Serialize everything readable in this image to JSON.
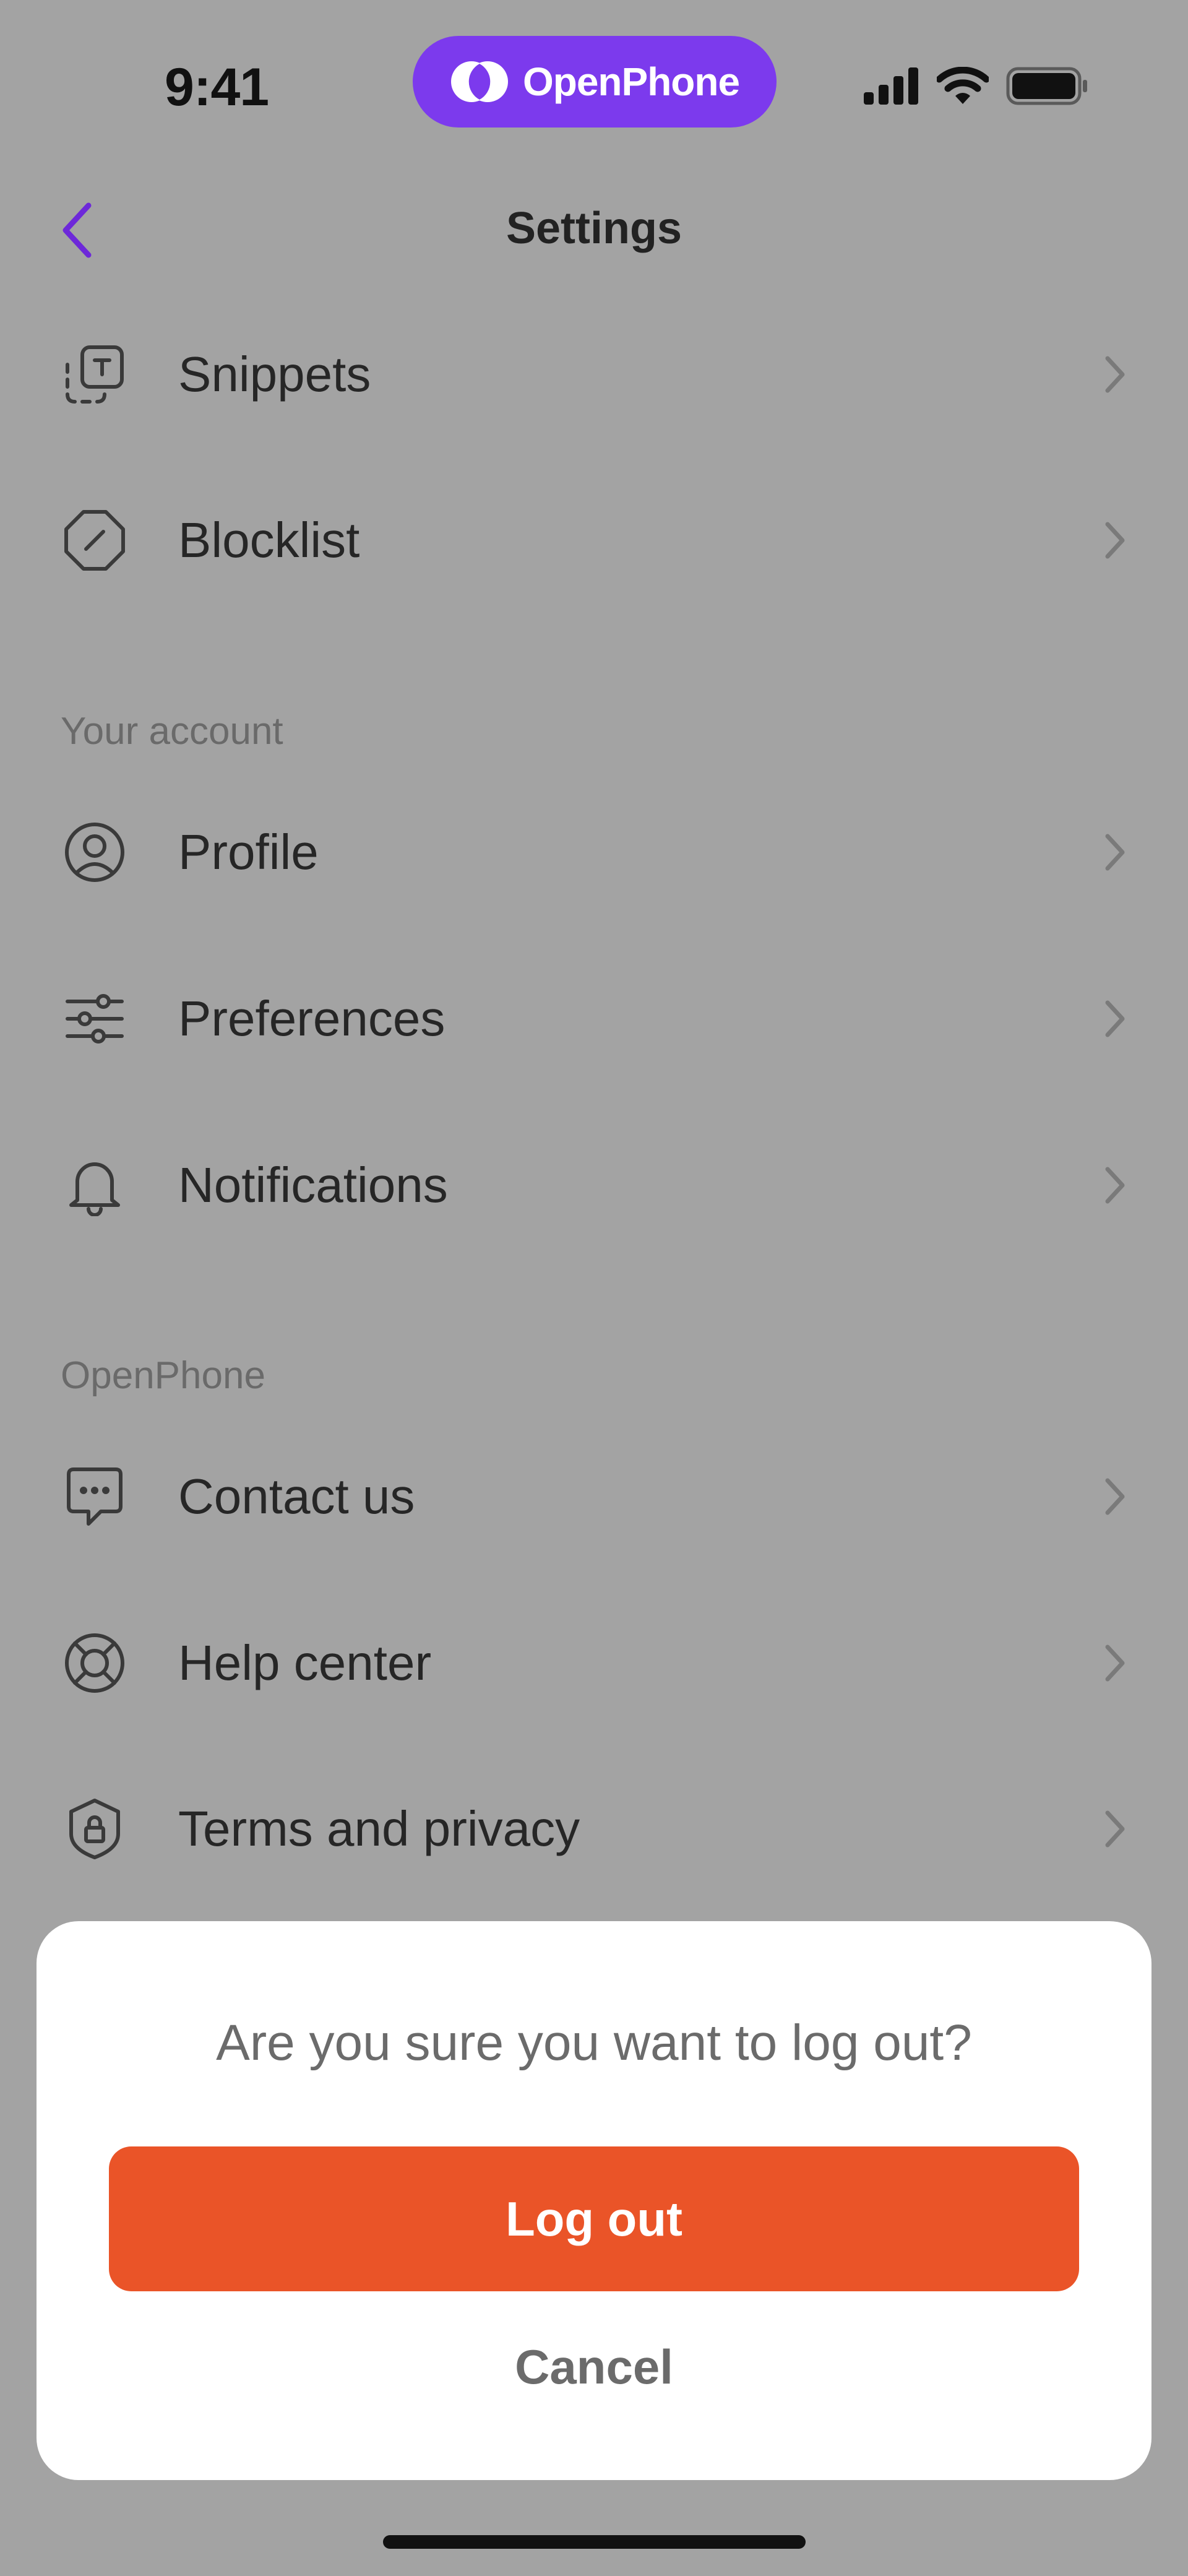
{
  "status_bar": {
    "time": "9:41",
    "brand": "OpenPhone",
    "icons": [
      "cellular-icon",
      "wifi-icon",
      "battery-icon"
    ]
  },
  "nav": {
    "back_icon": "chevron-left-icon",
    "title": "Settings"
  },
  "settings": {
    "items_top": [
      {
        "label": "Snippets",
        "icon": "snippets-icon"
      },
      {
        "label": "Blocklist",
        "icon": "block-icon"
      }
    ],
    "your_account": {
      "header": "Your account",
      "items": [
        {
          "label": "Profile",
          "icon": "profile-icon"
        },
        {
          "label": "Preferences",
          "icon": "sliders-icon"
        },
        {
          "label": "Notifications",
          "icon": "bell-icon"
        }
      ]
    },
    "openphone": {
      "header": "OpenPhone",
      "items": [
        {
          "label": "Contact us",
          "icon": "chat-icon"
        },
        {
          "label": "Help center",
          "icon": "lifebuoy-icon"
        },
        {
          "label": "Terms and privacy",
          "icon": "shield-lock-icon"
        }
      ]
    }
  },
  "dialog": {
    "question": "Are you sure you want to log out?",
    "confirm_label": "Log out",
    "cancel_label": "Cancel"
  },
  "colors": {
    "accent": "#7c3aed",
    "danger": "#ea5428",
    "overlay_bg": "#a3a3a3"
  }
}
